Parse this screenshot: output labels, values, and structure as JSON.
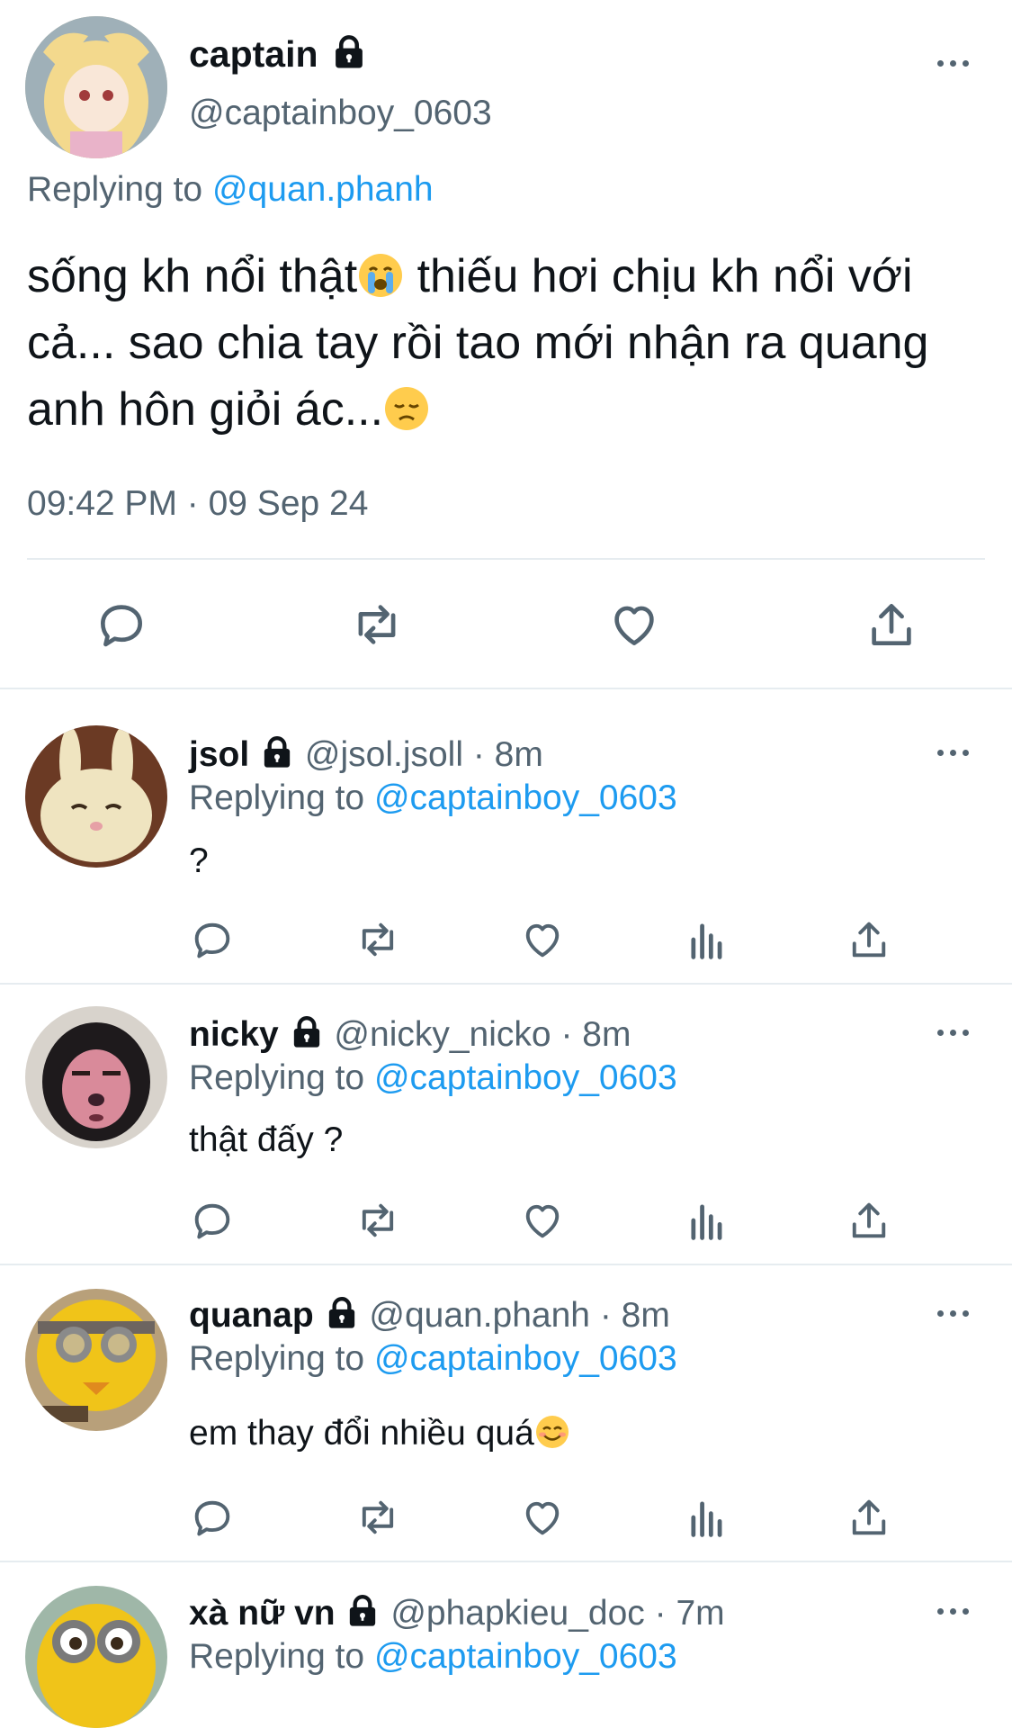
{
  "main": {
    "display_name": "captain",
    "handle": "@captainboy_0603",
    "replying_prefix": "Replying to",
    "replying_handle": "@quan.phanh",
    "text_line1": "sống kh nổi thật",
    "text_line1b": " thiếu hơi chịu kh nổi với",
    "text_line2": "cả... sao chia tay rồi tao mới nhận ra quang",
    "text_line3": "anh hôn giỏi ác...",
    "timestamp": "09:42 PM · 09 Sep 24",
    "emoji1": "loudly-crying-face",
    "emoji2": "disappointed-face"
  },
  "replies": [
    {
      "display_name": "jsol",
      "handle": "@jsol.jsoll",
      "time": "· 8m",
      "replying_prefix": "Replying to",
      "replying_handle": "@captainboy_0603",
      "text": "?"
    },
    {
      "display_name": "nicky",
      "handle": "@nicky_nicko",
      "time": "· 8m",
      "replying_prefix": "Replying to",
      "replying_handle": "@captainboy_0603",
      "text": "thật đấy ?"
    },
    {
      "display_name": "quanap",
      "handle": "@quan.phanh",
      "time": "· 8m",
      "replying_prefix": "Replying to",
      "replying_handle": "@captainboy_0603",
      "text": "em thay đổi nhiều quá",
      "emoji": "smiling-face-with-smiling-eyes"
    },
    {
      "display_name": "xà nữ vn",
      "handle": "@phapkieu_doc",
      "time": "· 7m",
      "replying_prefix": "Replying to",
      "replying_handle": "@captainboy_0603"
    }
  ],
  "colors": {
    "link": "#1d9bf0",
    "muted": "#536471",
    "divider": "#e6ecf0",
    "text": "#0f1419"
  }
}
